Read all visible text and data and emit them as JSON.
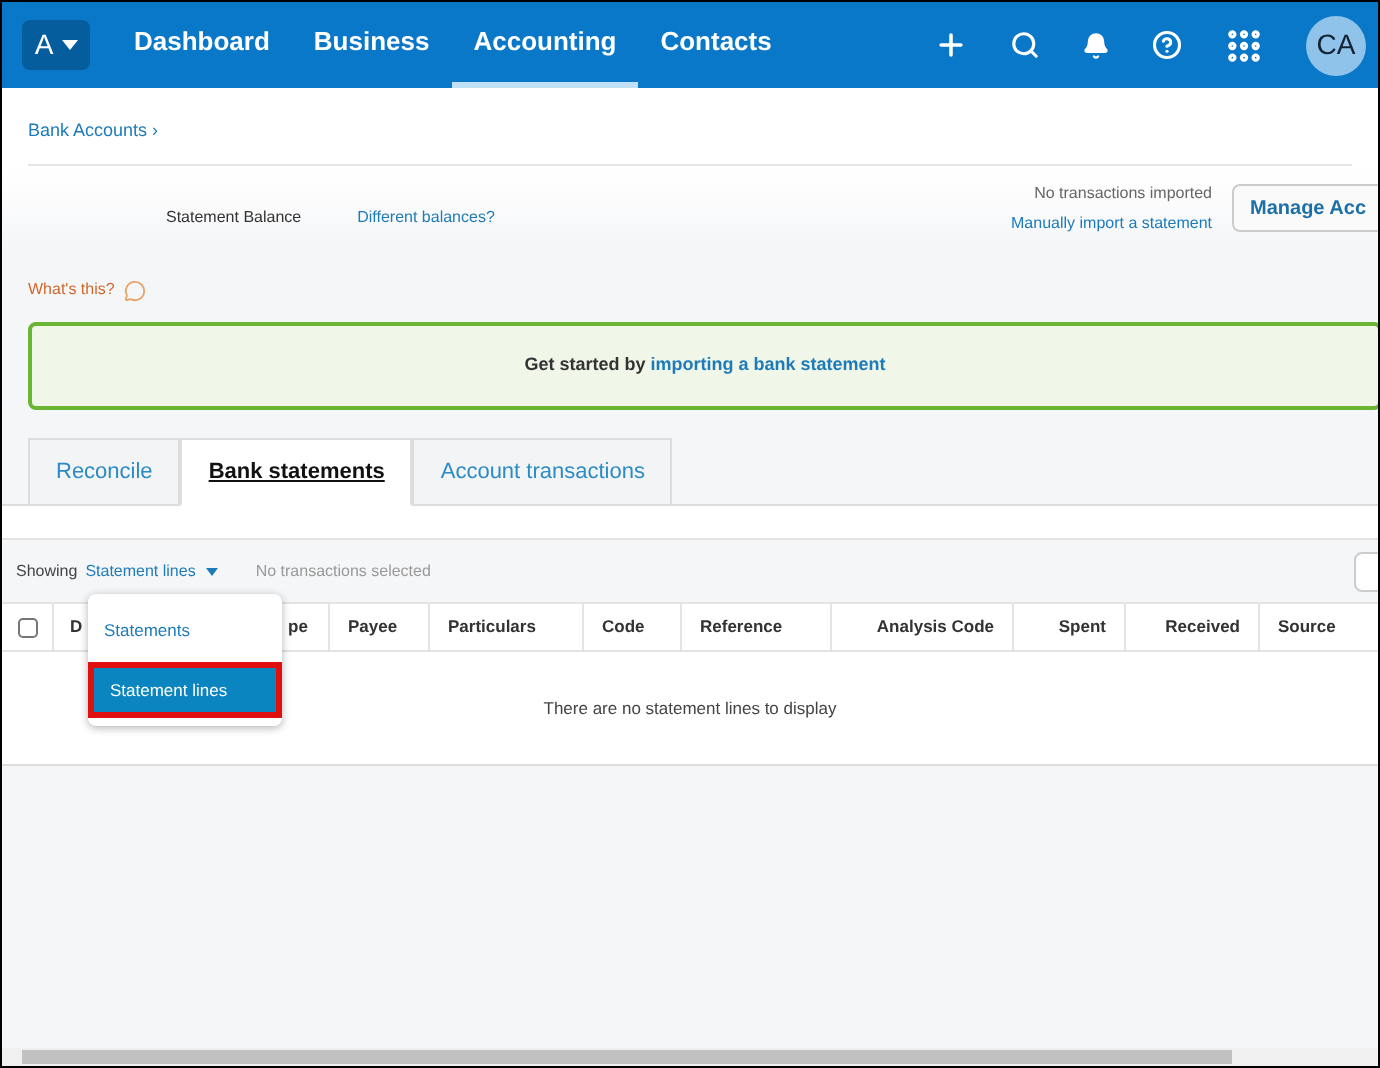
{
  "nav": {
    "org_button": "A",
    "items": [
      {
        "label": "Dashboard",
        "selected": false
      },
      {
        "label": "Business",
        "selected": false
      },
      {
        "label": "Accounting",
        "selected": true
      },
      {
        "label": "Contacts",
        "selected": false
      }
    ],
    "avatar": "CA"
  },
  "breadcrumb": "Bank Accounts ›",
  "summary": {
    "label": "Statement Balance",
    "link": "Different balances?",
    "status": "No transactions imported",
    "import_link": "Manually import a statement",
    "manage_button": "Manage Acc"
  },
  "help": "What's this?",
  "banner": {
    "text": "Get started by",
    "link": "importing a bank statement"
  },
  "tabs": [
    {
      "label": "Reconcile",
      "selected": false
    },
    {
      "label": "Bank statements",
      "selected": true
    },
    {
      "label": "Account transactions",
      "selected": false
    }
  ],
  "toolbar": {
    "showing": "Showing",
    "filter": "Statement lines",
    "selection": "No transactions selected"
  },
  "dropdown": {
    "open": true,
    "options": [
      {
        "label": "Statements",
        "selected": false
      },
      {
        "label": "Statement lines",
        "selected": true
      }
    ]
  },
  "table": {
    "select_all": {
      "checked": false
    },
    "columns": [
      {
        "label": "D"
      },
      {
        "label": "pe"
      },
      {
        "label": "Payee"
      },
      {
        "label": "Particulars"
      },
      {
        "label": "Code"
      },
      {
        "label": "Reference"
      },
      {
        "label": "Analysis Code"
      },
      {
        "label": "Spent"
      },
      {
        "label": "Received"
      },
      {
        "label": "Source"
      }
    ],
    "empty_message": "There are no statement lines to display"
  }
}
